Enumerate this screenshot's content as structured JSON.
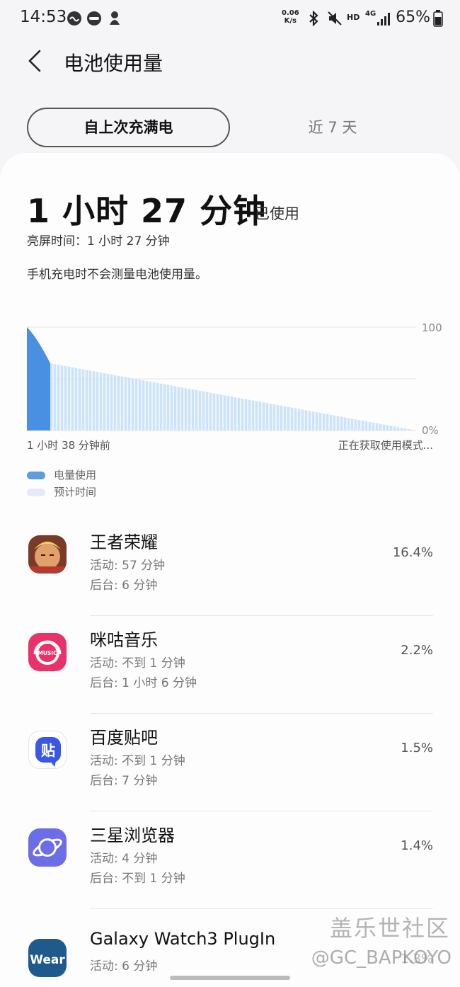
{
  "status_bar": {
    "time": "14:53",
    "net_speed_value": "0.06",
    "net_speed_unit": "K/s",
    "network": "4G",
    "hd": "HD",
    "battery": "65%"
  },
  "header": {
    "title": "电池使用量"
  },
  "tabs": [
    {
      "label": "自上次充满电",
      "active": true
    },
    {
      "label": "近 7 天",
      "active": false
    }
  ],
  "summary": {
    "usage": "1 小时 27 分钟",
    "usage_suffix": "已使用",
    "screen_time": "亮屏时间：1 小时 27 分钟",
    "charge_note": "手机充电时不会测量电池使用量。"
  },
  "chart_data": {
    "type": "area",
    "y_tick_labels": [
      "100",
      "0%"
    ],
    "ylim": [
      0,
      100
    ],
    "x_start_label": "1 小时 38 分钟前",
    "x_end_label": "正在获取使用模式...",
    "series": [
      {
        "name": "电量使用",
        "color": "#4a90e2",
        "x": [
          0,
          0.06
        ],
        "values": [
          100,
          65
        ]
      },
      {
        "name": "预计时间",
        "color": "#bcd9f5",
        "x": [
          0.06,
          1.0
        ],
        "values": [
          65,
          0
        ]
      }
    ],
    "grid": true
  },
  "legend": [
    {
      "label": "电量使用",
      "color": "#5b9de0"
    },
    {
      "label": "预计时间",
      "color": "#e6e9f8"
    }
  ],
  "apps": [
    {
      "name": "王者荣耀",
      "active": "活动: 57 分钟",
      "background": "后台: 6 分钟",
      "percent": "16.4%",
      "icon": "honor-of-kings-icon"
    },
    {
      "name": "咪咕音乐",
      "active": "活动: 不到 1 分钟",
      "background": "后台: 1 小时 6 分钟",
      "percent": "2.2%",
      "icon": "migu-music-icon",
      "icon_text": "MUSIC"
    },
    {
      "name": "百度贴吧",
      "active": "活动: 不到 1 分钟",
      "background": "后台: 7 分钟",
      "percent": "1.5%",
      "icon": "baidu-tieba-icon",
      "icon_text": "贴"
    },
    {
      "name": "三星浏览器",
      "active": "活动: 4 分钟",
      "background": "后台: 不到 1 分钟",
      "percent": "1.4%",
      "icon": "samsung-internet-icon"
    },
    {
      "name": "Galaxy Watch3 PlugIn",
      "active": "活动: 6 分钟",
      "background": "",
      "percent": "1.3%",
      "icon": "wear-icon",
      "icon_text": "Wear"
    }
  ],
  "watermark": {
    "line1": "盖乐世社区",
    "line2": "@GC_BAPKOYO"
  }
}
